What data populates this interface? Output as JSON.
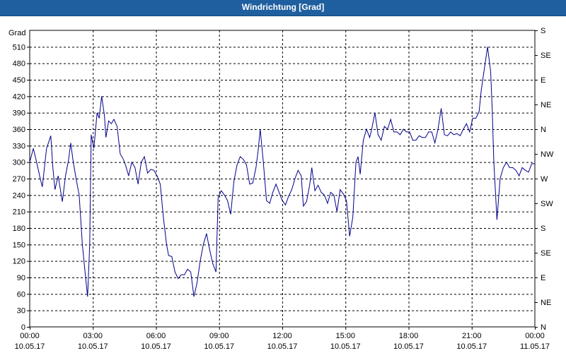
{
  "window": {
    "title": "Windrichtung [Grad]"
  },
  "chart_data": {
    "type": "line",
    "title": "Windrichtung [Grad]",
    "ylabel": "Grad",
    "ylim": [
      0,
      540
    ],
    "grid": true,
    "y_ticks": [
      0,
      30,
      60,
      90,
      120,
      150,
      180,
      210,
      240,
      270,
      300,
      330,
      360,
      390,
      420,
      450,
      480,
      510
    ],
    "y_ticks_right": [
      {
        "value": 0,
        "label": "N"
      },
      {
        "value": 45,
        "label": "NE"
      },
      {
        "value": 90,
        "label": "E"
      },
      {
        "value": 135,
        "label": "SE"
      },
      {
        "value": 180,
        "label": "S"
      },
      {
        "value": 225,
        "label": "SW"
      },
      {
        "value": 270,
        "label": "W"
      },
      {
        "value": 315,
        "label": "NW"
      },
      {
        "value": 360,
        "label": "N"
      },
      {
        "value": 405,
        "label": "NE"
      },
      {
        "value": 450,
        "label": "E"
      },
      {
        "value": 495,
        "label": "SE"
      },
      {
        "value": 540,
        "label": "S"
      }
    ],
    "x_ticks": [
      {
        "time": "00:00",
        "date": "10.05.17"
      },
      {
        "time": "03:00",
        "date": "10.05.17"
      },
      {
        "time": "06:00",
        "date": "10.05.17"
      },
      {
        "time": "09:00",
        "date": "10.05.17"
      },
      {
        "time": "12:00",
        "date": "10.05.17"
      },
      {
        "time": "15:00",
        "date": "10.05.17"
      },
      {
        "time": "18:00",
        "date": "10.05.17"
      },
      {
        "time": "21:00",
        "date": "10.05.17"
      },
      {
        "time": "00:00",
        "date": "11.05.17"
      }
    ],
    "x_hours": [
      0,
      3,
      6,
      9,
      12,
      15,
      18,
      21,
      24
    ],
    "line_color": "#00008b",
    "series": [
      {
        "points": [
          [
            0.0,
            300
          ],
          [
            0.17,
            325
          ],
          [
            0.33,
            300
          ],
          [
            0.5,
            270
          ],
          [
            0.6,
            255
          ],
          [
            0.8,
            325
          ],
          [
            1.0,
            348
          ],
          [
            1.1,
            290
          ],
          [
            1.2,
            250
          ],
          [
            1.35,
            275
          ],
          [
            1.5,
            240
          ],
          [
            1.55,
            228
          ],
          [
            1.7,
            275
          ],
          [
            1.85,
            305
          ],
          [
            1.95,
            335
          ],
          [
            2.05,
            305
          ],
          [
            2.2,
            270
          ],
          [
            2.35,
            240
          ],
          [
            2.5,
            150
          ],
          [
            2.63,
            100
          ],
          [
            2.75,
            55
          ],
          [
            2.85,
            150
          ],
          [
            2.92,
            350
          ],
          [
            3.05,
            325
          ],
          [
            3.2,
            390
          ],
          [
            3.3,
            380
          ],
          [
            3.42,
            420
          ],
          [
            3.55,
            385
          ],
          [
            3.62,
            345
          ],
          [
            3.75,
            375
          ],
          [
            3.88,
            370
          ],
          [
            4.0,
            378
          ],
          [
            4.15,
            365
          ],
          [
            4.3,
            315
          ],
          [
            4.45,
            305
          ],
          [
            4.55,
            295
          ],
          [
            4.7,
            275
          ],
          [
            4.85,
            300
          ],
          [
            5.0,
            290
          ],
          [
            5.15,
            260
          ],
          [
            5.3,
            300
          ],
          [
            5.45,
            310
          ],
          [
            5.6,
            280
          ],
          [
            5.75,
            287
          ],
          [
            5.9,
            285
          ],
          [
            6.05,
            275
          ],
          [
            6.2,
            260
          ],
          [
            6.35,
            200
          ],
          [
            6.5,
            150
          ],
          [
            6.6,
            130
          ],
          [
            6.75,
            128
          ],
          [
            6.9,
            100
          ],
          [
            7.05,
            88
          ],
          [
            7.2,
            95
          ],
          [
            7.35,
            95
          ],
          [
            7.5,
            105
          ],
          [
            7.65,
            100
          ],
          [
            7.8,
            55
          ],
          [
            7.95,
            80
          ],
          [
            8.1,
            120
          ],
          [
            8.25,
            150
          ],
          [
            8.4,
            170
          ],
          [
            8.55,
            140
          ],
          [
            8.7,
            115
          ],
          [
            8.85,
            100
          ],
          [
            8.95,
            235
          ],
          [
            9.1,
            248
          ],
          [
            9.25,
            240
          ],
          [
            9.4,
            230
          ],
          [
            9.55,
            205
          ],
          [
            9.7,
            265
          ],
          [
            9.85,
            295
          ],
          [
            10.0,
            310
          ],
          [
            10.15,
            305
          ],
          [
            10.3,
            295
          ],
          [
            10.45,
            260
          ],
          [
            10.6,
            262
          ],
          [
            10.75,
            290
          ],
          [
            10.85,
            320
          ],
          [
            10.95,
            360
          ],
          [
            11.1,
            300
          ],
          [
            11.25,
            230
          ],
          [
            11.4,
            225
          ],
          [
            11.55,
            245
          ],
          [
            11.7,
            260
          ],
          [
            11.85,
            245
          ],
          [
            12.0,
            230
          ],
          [
            12.15,
            222
          ],
          [
            12.3,
            238
          ],
          [
            12.45,
            250
          ],
          [
            12.6,
            270
          ],
          [
            12.75,
            285
          ],
          [
            12.9,
            275
          ],
          [
            13.0,
            220
          ],
          [
            13.15,
            228
          ],
          [
            13.3,
            258
          ],
          [
            13.4,
            290
          ],
          [
            13.55,
            248
          ],
          [
            13.7,
            258
          ],
          [
            13.85,
            245
          ],
          [
            14.0,
            240
          ],
          [
            14.15,
            225
          ],
          [
            14.3,
            245
          ],
          [
            14.45,
            240
          ],
          [
            14.6,
            210
          ],
          [
            14.75,
            250
          ],
          [
            14.9,
            242
          ],
          [
            15.05,
            230
          ],
          [
            15.2,
            165
          ],
          [
            15.35,
            200
          ],
          [
            15.5,
            300
          ],
          [
            15.6,
            310
          ],
          [
            15.7,
            278
          ],
          [
            15.85,
            340
          ],
          [
            16.0,
            360
          ],
          [
            16.15,
            345
          ],
          [
            16.25,
            360
          ],
          [
            16.4,
            390
          ],
          [
            16.55,
            350
          ],
          [
            16.7,
            340
          ],
          [
            16.85,
            365
          ],
          [
            17.0,
            360
          ],
          [
            17.15,
            378
          ],
          [
            17.3,
            355
          ],
          [
            17.45,
            355
          ],
          [
            17.6,
            350
          ],
          [
            17.75,
            360
          ],
          [
            17.9,
            355
          ],
          [
            18.05,
            355
          ],
          [
            18.2,
            340
          ],
          [
            18.35,
            340
          ],
          [
            18.5,
            348
          ],
          [
            18.65,
            345
          ],
          [
            18.8,
            345
          ],
          [
            18.95,
            355
          ],
          [
            19.1,
            355
          ],
          [
            19.25,
            335
          ],
          [
            19.4,
            360
          ],
          [
            19.55,
            398
          ],
          [
            19.7,
            350
          ],
          [
            19.85,
            348
          ],
          [
            20.0,
            355
          ],
          [
            20.15,
            350
          ],
          [
            20.3,
            352
          ],
          [
            20.45,
            348
          ],
          [
            20.6,
            360
          ],
          [
            20.75,
            370
          ],
          [
            20.9,
            355
          ],
          [
            21.05,
            380
          ],
          [
            21.2,
            380
          ],
          [
            21.35,
            392
          ],
          [
            21.45,
            430
          ],
          [
            21.6,
            470
          ],
          [
            21.75,
            510
          ],
          [
            21.9,
            465
          ],
          [
            21.97,
            400
          ],
          [
            22.05,
            300
          ],
          [
            22.2,
            195
          ],
          [
            22.35,
            270
          ],
          [
            22.5,
            290
          ],
          [
            22.65,
            300
          ],
          [
            22.8,
            290
          ],
          [
            22.95,
            290
          ],
          [
            23.1,
            285
          ],
          [
            23.25,
            275
          ],
          [
            23.4,
            290
          ],
          [
            23.55,
            285
          ],
          [
            23.7,
            282
          ],
          [
            23.85,
            297
          ],
          [
            24.0,
            297
          ]
        ]
      }
    ]
  }
}
